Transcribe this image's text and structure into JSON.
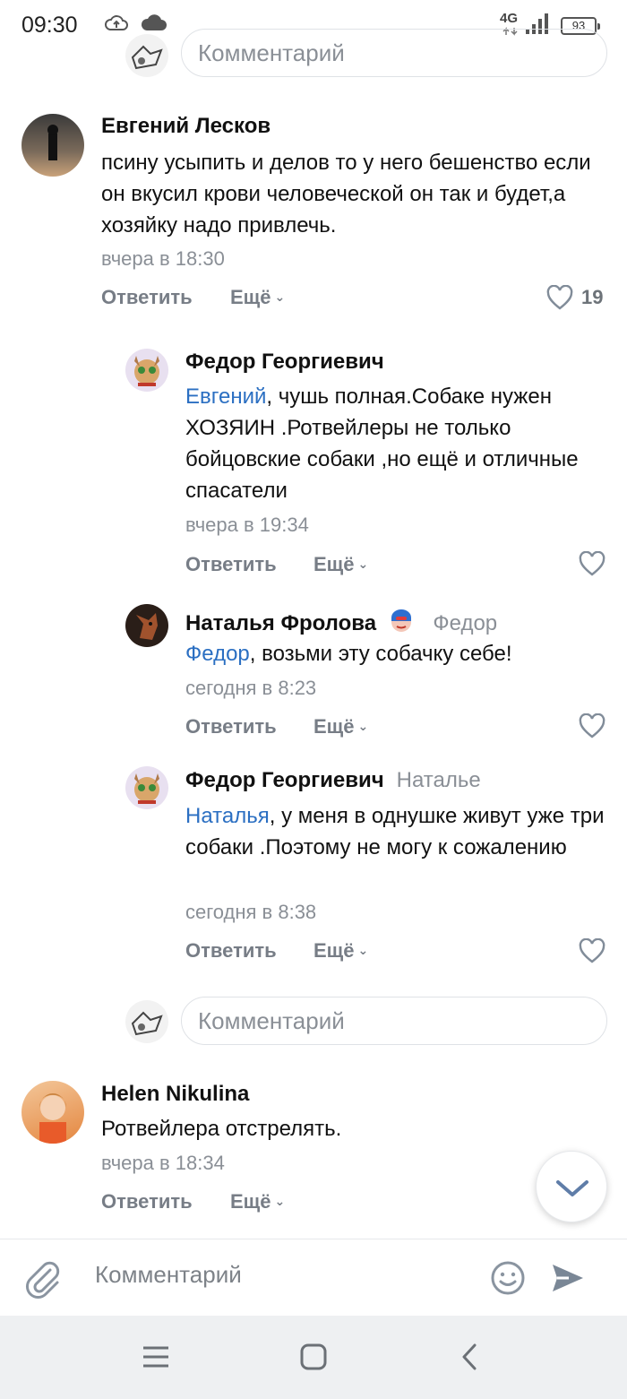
{
  "status_bar": {
    "time": "09:30",
    "network": "4G",
    "battery": "93"
  },
  "top_comment_input": {
    "placeholder": "Комментарий"
  },
  "comments": [
    {
      "author": "Евгений Лесков",
      "text": "псину усыпить и делов то у него бешенство если он вкусил крови человеческой он так и будет,а хозяйку надо привлечь.",
      "time": "вчера в 18:30",
      "reply_label": "Ответить",
      "more_label": "Ещё",
      "likes": "19"
    },
    {
      "author": "Федор Георгиевич",
      "mention": "Евгений",
      "text": ", чушь полная.Собаке нужен ХОЗЯИН .Ротвейлеры не только бойцовские собаки ,но ещё и отличные спасатели",
      "time": "вчера в 19:34",
      "reply_label": "Ответить",
      "more_label": "Ещё"
    },
    {
      "author": "Наталья Фролова",
      "reply_to": "Федор",
      "mention": "Федор",
      "text": ", возьми эту собачку себе!",
      "time": "сегодня в 8:23",
      "reply_label": "Ответить",
      "more_label": "Ещё"
    },
    {
      "author": "Федор Георгиевич",
      "reply_to": "Наталье",
      "mention": "Наталья",
      "text": ", у меня в однушке живут уже три собаки .Поэтому не могу к сожалению",
      "time": "сегодня в 8:38",
      "reply_label": "Ответить",
      "more_label": "Ещё"
    },
    {
      "author": "Helen Nikulina",
      "text": "Ротвейлера отстрелять.",
      "time": "вчера в 18:34",
      "reply_label": "Ответить",
      "more_label": "Ещё"
    }
  ],
  "thread_comment_input": {
    "placeholder": "Комментарий"
  },
  "composer": {
    "placeholder": "Комментарий"
  },
  "colors": {
    "accent": "#2b6fc2",
    "secondary_text": "#8a8f96",
    "action": "#777d86"
  }
}
